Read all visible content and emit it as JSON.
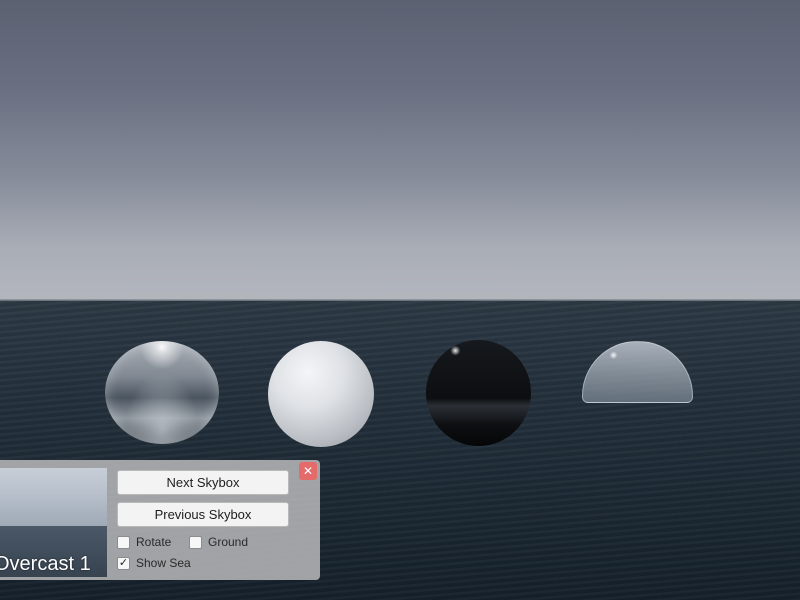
{
  "scene": {
    "spheres": [
      {
        "name": "glass-sphere"
      },
      {
        "name": "white-sphere"
      },
      {
        "name": "black-sphere"
      },
      {
        "name": "clear-dome"
      }
    ]
  },
  "panel": {
    "preview_label": "Overcast 1",
    "next_button": "Next Skybox",
    "previous_button": "Previous Skybox",
    "close_glyph": "✕",
    "options": {
      "rotate": {
        "label": "Rotate",
        "checked": false
      },
      "ground": {
        "label": "Ground",
        "checked": false
      },
      "show_sea": {
        "label": "Show Sea",
        "checked": true,
        "mark": "✓"
      }
    },
    "colors": {
      "close": "#e56a6a",
      "panel": "#bebec0"
    }
  }
}
